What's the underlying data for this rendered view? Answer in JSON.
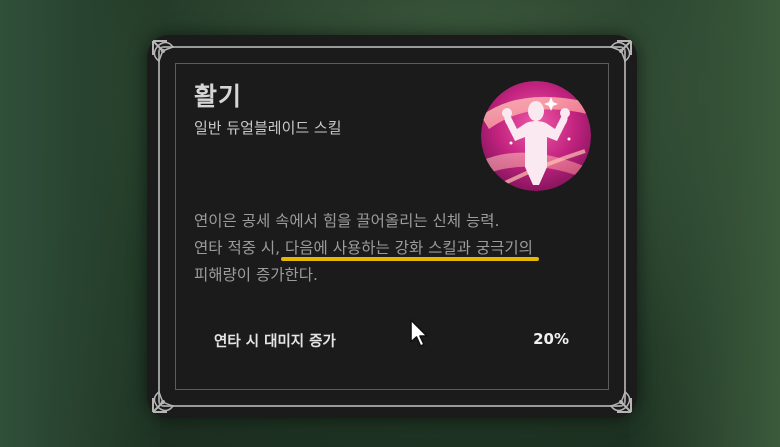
{
  "skill": {
    "name": "활기",
    "type": "일반 듀얼블레이드 스킬",
    "icon": "flexing-figure-emblem-icon",
    "description": {
      "line1": "연이은 공세 속에서 힘을 끌어올리는 신체 능력.",
      "line2_prefix": "연타 적중 시, ",
      "line2_highlight": "다음에 사용하는 강화 스킬과 궁극기의",
      "line3": "피해량이 증가한다."
    },
    "stat": {
      "label": "연타 시 대미지 증가",
      "value": "20%"
    }
  },
  "colors": {
    "highlight": "#e6b800",
    "emblem_magenta": "#c2237f",
    "card_background": "#1b1b1b"
  }
}
